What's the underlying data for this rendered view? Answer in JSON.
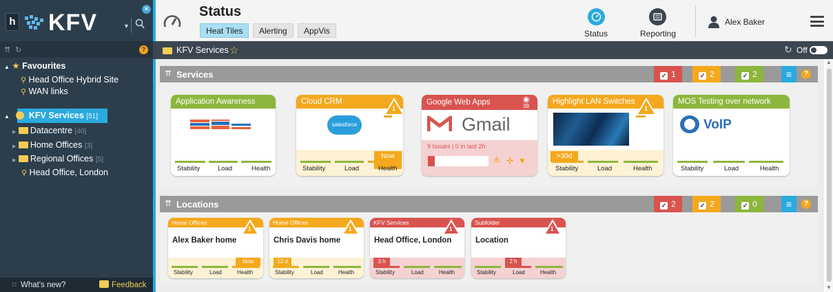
{
  "sidebar": {
    "logo_letter": "h",
    "logo_text": "KFV",
    "favourites_label": "Favourites",
    "favourites": [
      "Head Office Hybrid Site",
      "WAN links"
    ],
    "tree": [
      {
        "label": "KFV Services",
        "count": "[51]"
      },
      {
        "label": "Datacentre",
        "count": "[40]"
      },
      {
        "label": "Home Offices",
        "count": "[3]"
      },
      {
        "label": "Regional Offices",
        "count": "[5]"
      },
      {
        "label": "Head Office, London",
        "count": ""
      }
    ],
    "whats_new": "What's new?",
    "feedback": "Feedback",
    "help_mark": "?",
    "close_mark": "×"
  },
  "header": {
    "title": "Status",
    "tabs": [
      "Heat Tiles",
      "Alerting",
      "AppVis"
    ],
    "status_label": "Status",
    "reporting_label": "Reporting",
    "user_name": "Alex Baker"
  },
  "subheader": {
    "title": "KFV Services",
    "auto_refresh_label": "Off"
  },
  "services": {
    "title": "Services",
    "counts": {
      "red": "1",
      "yellow": "2",
      "green": "2"
    },
    "tiles": [
      {
        "title": "Application Awareness",
        "theme": "green",
        "warn_count": "",
        "note": "",
        "now": ""
      },
      {
        "title": "Cloud CRM",
        "theme": "yellow",
        "warn_count": "1",
        "logo_text": "salesforce",
        "now": "Now"
      },
      {
        "title": "Google Web Apps",
        "theme": "red",
        "watch_count": "39",
        "logo_text": "Gmail",
        "issues": "9 Issues | 0 in last 2h"
      },
      {
        "title": "Highlight LAN Switches",
        "theme": "yellow",
        "warn_count": "1",
        "age": ">30d"
      },
      {
        "title": "MOS Testing over network",
        "theme": "green",
        "logo_text": "VoIP"
      }
    ]
  },
  "locations": {
    "title": "Locations",
    "counts": {
      "red": "2",
      "yellow": "2",
      "green": "0"
    },
    "tiles": [
      {
        "group": "Home Offices",
        "title": "Alex Baker home",
        "theme": "yellow",
        "warn_count": "1",
        "badge": "Now"
      },
      {
        "group": "Home Offices",
        "title": "Chris Davis home",
        "theme": "yellow",
        "warn_count": "1",
        "badge": "12 d"
      },
      {
        "group": "KFV Services",
        "title": "Head Office, London",
        "theme": "red",
        "warn_count": "1",
        "badge": "3 h"
      },
      {
        "group": "Subfolder",
        "title": "Location",
        "theme": "red",
        "warn_count": "1",
        "badge": "2 h"
      }
    ]
  },
  "bar_labels": {
    "stability": "Stability",
    "load": "Load",
    "health": "Health"
  },
  "colors": {
    "green": "#8cb63c",
    "yellow": "#f4a81d",
    "red": "#d9534f",
    "blue": "#2aaadf",
    "sidebar": "#2c3e4c"
  }
}
